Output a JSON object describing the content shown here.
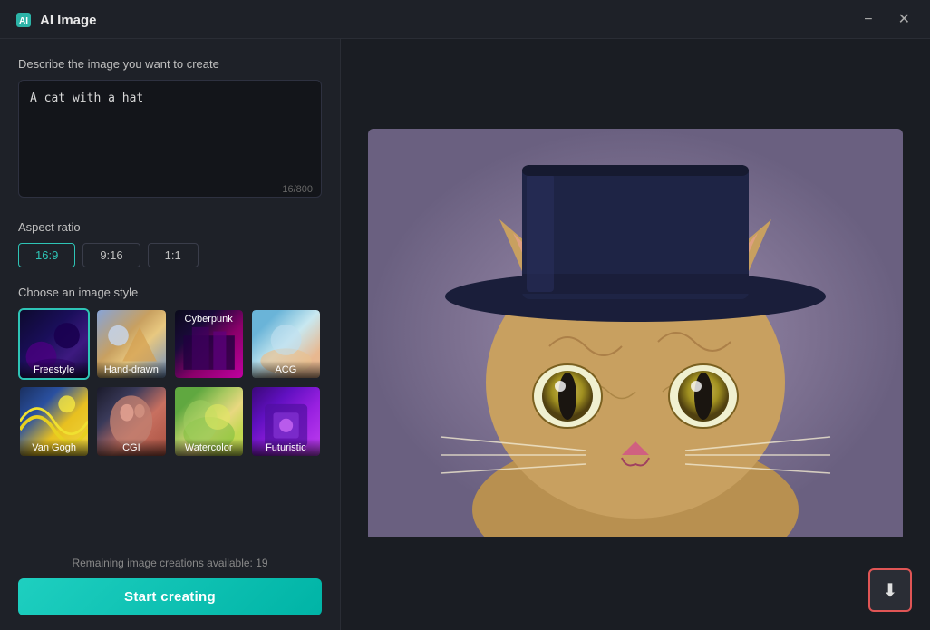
{
  "window": {
    "title": "AI Image",
    "minimize_label": "−",
    "close_label": "✕"
  },
  "left_panel": {
    "prompt_label": "Describe the image you want to create",
    "prompt_value": "A cat with a hat",
    "char_count": "16/800",
    "aspect_label": "Aspect ratio",
    "aspect_options": [
      {
        "label": "16:9",
        "active": true
      },
      {
        "label": "9:16",
        "active": false
      },
      {
        "label": "1:1",
        "active": false
      }
    ],
    "style_label": "Choose an image style",
    "styles": [
      {
        "id": "freestyle",
        "label": "Freestyle",
        "top_label": "",
        "thumb_class": "thumb-freestyle",
        "active": true
      },
      {
        "id": "handdrawn",
        "label": "Hand-drawn",
        "top_label": "",
        "thumb_class": "thumb-handdrawn",
        "active": false
      },
      {
        "id": "cyberpunk",
        "label": "",
        "top_label": "Cyberpunk",
        "thumb_class": "thumb-cyberpunk",
        "active": false
      },
      {
        "id": "acg",
        "label": "ACG",
        "top_label": "",
        "thumb_class": "thumb-acg",
        "active": false
      },
      {
        "id": "vangogh",
        "label": "Van Gogh",
        "top_label": "",
        "thumb_class": "thumb-vangogh",
        "active": false
      },
      {
        "id": "cgi",
        "label": "CGI",
        "top_label": "",
        "thumb_class": "thumb-cgi",
        "active": false
      },
      {
        "id": "watercolor",
        "label": "Watercolor",
        "top_label": "",
        "thumb_class": "thumb-watercolor",
        "active": false
      },
      {
        "id": "futuristic",
        "label": "Futuristic",
        "top_label": "",
        "thumb_class": "thumb-futuristic",
        "active": false
      }
    ],
    "remaining_text": "Remaining image creations available: 19",
    "start_button_label": "Start creating"
  },
  "right_panel": {
    "download_icon": "⬇"
  }
}
